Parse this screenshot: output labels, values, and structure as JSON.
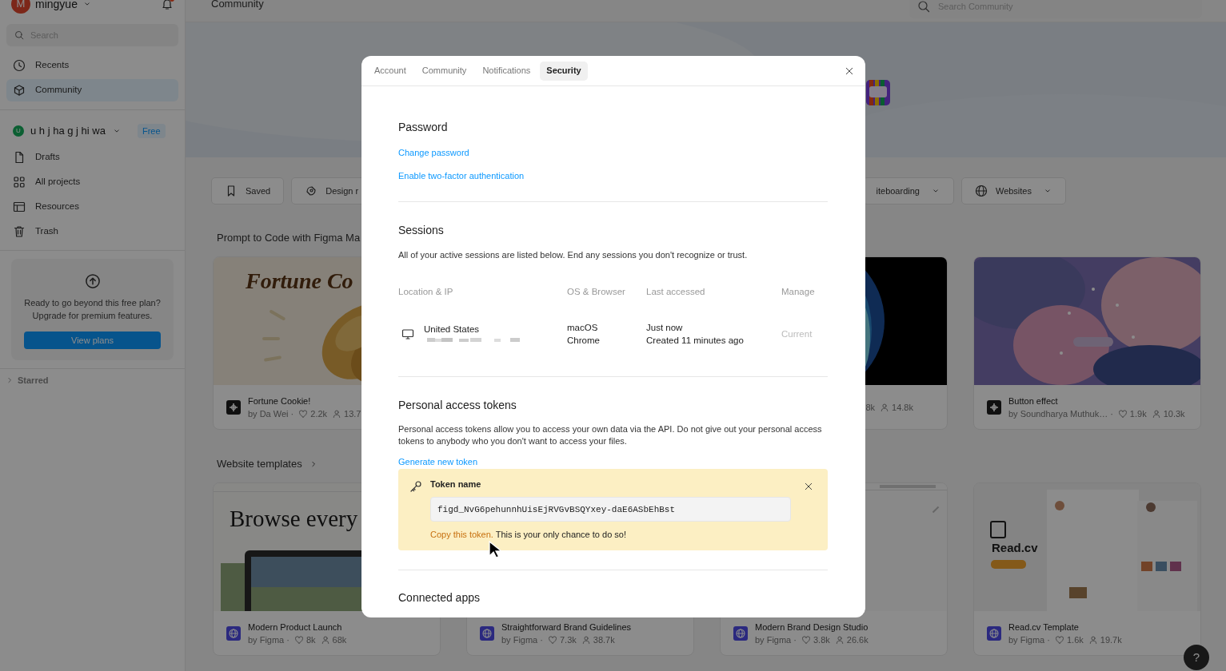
{
  "sidebar": {
    "account": {
      "initial": "M",
      "name": "mingyue",
      "notifications": true
    },
    "search": {
      "placeholder": "Search"
    },
    "nav": [
      {
        "label": "Recents",
        "selected": false
      },
      {
        "label": "Community",
        "selected": true
      }
    ],
    "team": {
      "initial": "U",
      "name": "u h j ha g j hi wa",
      "plan": "Free"
    },
    "team_nav": [
      {
        "label": "Drafts",
        "selected": false
      },
      {
        "label": "All projects",
        "selected": false
      },
      {
        "label": "Resources",
        "selected": false
      },
      {
        "label": "Trash",
        "selected": false
      }
    ],
    "upgrade": {
      "text": "Ready to go beyond this free plan? Upgrade for premium features.",
      "button": "View plans"
    },
    "starred": {
      "label": "Starred",
      "expanded": false
    }
  },
  "header": {
    "title": "Community",
    "search": {
      "placeholder": "Search Community"
    }
  },
  "filters": [
    {
      "label": "Saved",
      "dropdown": false
    },
    {
      "label": "Design r",
      "dropdown": false
    },
    {
      "label": "iteboarding",
      "dropdown": true
    },
    {
      "label": "Websites",
      "dropdown": true
    }
  ],
  "sections": [
    {
      "title": "Prompt to Code with Figma Ma",
      "arrow": false,
      "cards": [
        {
          "kind": "plugin",
          "thumb_text": "Fortune Co",
          "title": "Fortune Cookie!",
          "author": "by Da Wei ·",
          "stats": [
            {
              "kind": "likes",
              "value": "2.2k"
            },
            {
              "kind": "users",
              "value": "13.7"
            }
          ]
        },
        {
          "stats": [
            {
              "kind": "text",
              "value": "8k"
            },
            {
              "kind": "users",
              "value": "14.8k"
            }
          ]
        },
        {
          "kind": "plugin",
          "title": "Button effect",
          "author": "by Soundharya Muthuk… ·",
          "stats": [
            {
              "kind": "likes",
              "value": "1.9k"
            },
            {
              "kind": "users",
              "value": "10.3k"
            }
          ]
        }
      ]
    },
    {
      "title": "Website templates",
      "arrow": true,
      "cards": [
        {
          "kind": "site",
          "thumb_text": "Browse every",
          "title": "Modern Product Launch",
          "author": "by Figma ·",
          "stats": [
            {
              "kind": "likes",
              "value": "8k"
            },
            {
              "kind": "users",
              "value": "68k"
            }
          ]
        },
        {
          "kind": "site",
          "title": "Straightforward Brand Guidelines",
          "author": "by Figma ·",
          "stats": [
            {
              "kind": "likes",
              "value": "7.3k"
            },
            {
              "kind": "users",
              "value": "38.7k"
            }
          ]
        },
        {
          "kind": "site",
          "title": "Modern Brand Design Studio",
          "author": "by Figma ·",
          "stats": [
            {
              "kind": "likes",
              "value": "3.8k"
            },
            {
              "kind": "users",
              "value": "26.6k"
            }
          ]
        },
        {
          "kind": "site",
          "thumb_text": "Read.cv",
          "title": "Read.cv Template",
          "author": "by Figma ·",
          "stats": [
            {
              "kind": "likes",
              "value": "1.6k"
            },
            {
              "kind": "users",
              "value": "19.7k"
            }
          ]
        }
      ]
    }
  ],
  "dialog": {
    "tabs": [
      {
        "label": "Account",
        "selected": false
      },
      {
        "label": "Community",
        "selected": false
      },
      {
        "label": "Notifications",
        "selected": false
      },
      {
        "label": "Security",
        "selected": true
      }
    ],
    "password": {
      "title": "Password",
      "links": [
        "Change password",
        "Enable two-factor authentication"
      ]
    },
    "sessions": {
      "title": "Sessions",
      "description": "All of your active sessions are listed below. End any sessions you don't recognize or trust.",
      "columns": [
        "Location & IP",
        "OS & Browser",
        "Last accessed",
        "Manage"
      ],
      "rows": [
        {
          "location": "United States",
          "os": "macOS",
          "browser": "Chrome",
          "last_accessed": "Just now",
          "created": "Created 11 minutes ago",
          "manage": "Current"
        }
      ]
    },
    "tokens": {
      "title": "Personal access tokens",
      "description": "Personal access tokens allow you to access your own data via the API. Do not give out your personal access tokens to anybody who you don't want to access your files.",
      "link": "Generate new token",
      "new_token": {
        "label": "Token name",
        "value": "figd_NvG6pehunnhUisEjRVGvBSQYxey-daE6ASbEhBst",
        "warning": "Copy this token.",
        "note": "This is your only chance to do so!"
      }
    },
    "connected_apps": {
      "title": "Connected apps"
    }
  },
  "help_button": "?"
}
